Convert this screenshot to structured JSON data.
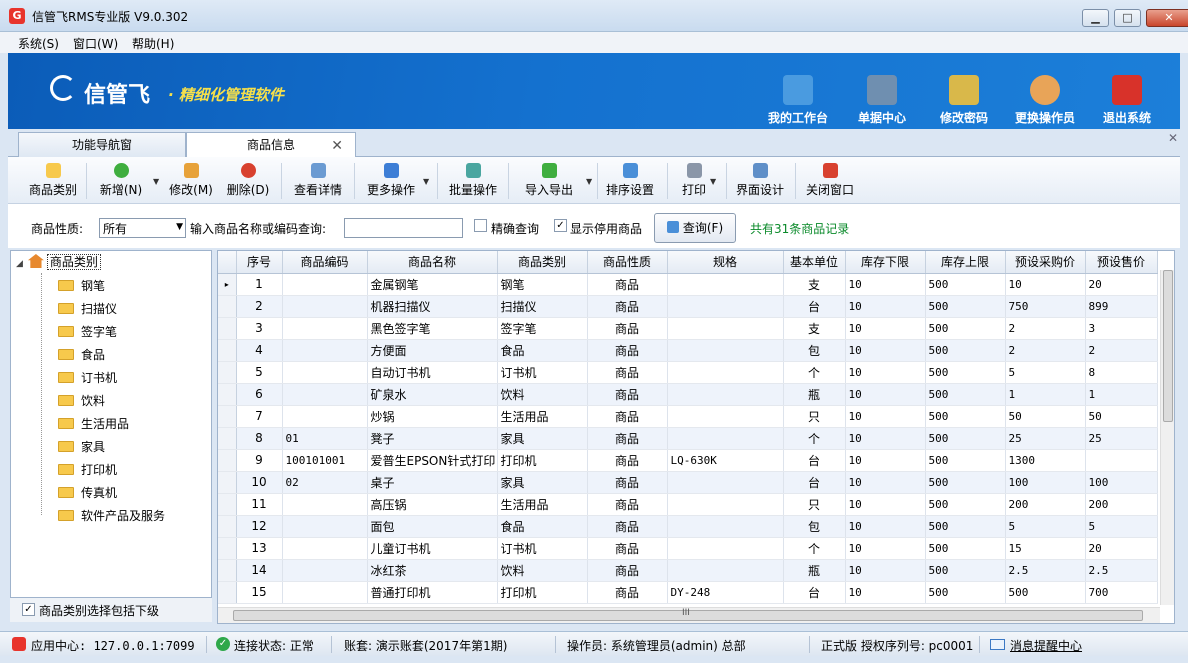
{
  "window": {
    "title": "信管飞RMS专业版 V9.0.302",
    "minimize": "▁",
    "maximize": "□",
    "close": "✕"
  },
  "menu": [
    "系统(S)",
    "窗口(W)",
    "帮助(H)"
  ],
  "banner": {
    "brand": "信管飞",
    "slogan": "· 精细化管理软件",
    "nav": [
      {
        "label": "我的工作台",
        "icon": "monitor-icon",
        "color": "#4a9be0"
      },
      {
        "label": "单据中心",
        "icon": "document-list-icon",
        "color": "#6f8fb0"
      },
      {
        "label": "修改密码",
        "icon": "lock-icon",
        "color": "#d9b84a"
      },
      {
        "label": "更换操作员",
        "icon": "user-icon",
        "color": "#e8a458"
      },
      {
        "label": "退出系统",
        "icon": "power-icon",
        "color": "#d8322a"
      }
    ]
  },
  "tabs": {
    "nav": "功能导航窗",
    "goods": "商品信息",
    "close": "✕"
  },
  "panel_close": "✕",
  "toolbar": [
    {
      "label": "商品类别",
      "icon": "folder-icon",
      "color": "#f7c94c"
    },
    {
      "label": "新增(N)",
      "icon": "add-icon",
      "color": "#3fae3f",
      "dropdown": true
    },
    {
      "label": "修改(M)",
      "icon": "edit-icon",
      "color": "#e7a23a"
    },
    {
      "label": "删除(D)",
      "icon": "delete-icon",
      "color": "#d8412f"
    },
    {
      "label": "查看详情",
      "icon": "details-icon",
      "color": "#6b9bd2"
    },
    {
      "label": "更多操作",
      "icon": "more-icon",
      "color": "#3d7ed6",
      "dropdown": true
    },
    {
      "label": "批量操作",
      "icon": "batch-icon",
      "color": "#4aa6a0"
    },
    {
      "label": "导入导出",
      "icon": "import-export-icon",
      "color": "#3fae3f",
      "dropdown": true
    },
    {
      "label": "排序设置",
      "icon": "sort-icon",
      "color": "#4a8fd8"
    },
    {
      "label": "打印",
      "icon": "print-icon",
      "color": "#8a96a8",
      "dropdown": true
    },
    {
      "label": "界面设计",
      "icon": "layout-icon",
      "color": "#5f8fc8"
    },
    {
      "label": "关闭窗口",
      "icon": "close-window-icon",
      "color": "#d8412f"
    }
  ],
  "filter": {
    "property_label": "商品性质:",
    "property_value": "所有",
    "search_label": "输入商品名称或编码查询:",
    "search_value": "",
    "exact_label": "精确查询",
    "exact_checked": false,
    "show_disabled_label": "显示停用商品",
    "show_disabled_checked": true,
    "query_button": "查询(F)",
    "count_text": "共有31条商品记录"
  },
  "tree": {
    "root": "商品类别",
    "items": [
      "钢笔",
      "扫描仪",
      "签字笔",
      "食品",
      "订书机",
      "饮料",
      "生活用品",
      "家具",
      "打印机",
      "传真机",
      "软件产品及服务"
    ],
    "include_sub_label": "商品类别选择包括下级",
    "include_sub_checked": true
  },
  "grid": {
    "columns": [
      "序号",
      "商品编码",
      "商品名称",
      "商品类别",
      "商品性质",
      "规格",
      "基本单位",
      "库存下限",
      "库存上限",
      "预设采购价",
      "预设售价"
    ],
    "rows": [
      [
        "1",
        "",
        "金属钢笔",
        "钢笔",
        "商品",
        "",
        "支",
        "10",
        "500",
        "10",
        "20"
      ],
      [
        "2",
        "",
        "机器扫描仪",
        "扫描仪",
        "商品",
        "",
        "台",
        "10",
        "500",
        "750",
        "899"
      ],
      [
        "3",
        "",
        "黑色签字笔",
        "签字笔",
        "商品",
        "",
        "支",
        "10",
        "500",
        "2",
        "3"
      ],
      [
        "4",
        "",
        "方便面",
        "食品",
        "商品",
        "",
        "包",
        "10",
        "500",
        "2",
        "2"
      ],
      [
        "5",
        "",
        "自动订书机",
        "订书机",
        "商品",
        "",
        "个",
        "10",
        "500",
        "5",
        "8"
      ],
      [
        "6",
        "",
        "矿泉水",
        "饮料",
        "商品",
        "",
        "瓶",
        "10",
        "500",
        "1",
        "1"
      ],
      [
        "7",
        "",
        "炒锅",
        "生活用品",
        "商品",
        "",
        "只",
        "10",
        "500",
        "50",
        "50"
      ],
      [
        "8",
        "01",
        "凳子",
        "家具",
        "商品",
        "",
        "个",
        "10",
        "500",
        "25",
        "25"
      ],
      [
        "9",
        "100101001",
        "爱普生EPSON针式打印",
        "打印机",
        "商品",
        "LQ-630K",
        "台",
        "10",
        "500",
        "1300",
        ""
      ],
      [
        "10",
        "02",
        "桌子",
        "家具",
        "商品",
        "",
        "台",
        "10",
        "500",
        "100",
        "100"
      ],
      [
        "11",
        "",
        "高压锅",
        "生活用品",
        "商品",
        "",
        "只",
        "10",
        "500",
        "200",
        "200"
      ],
      [
        "12",
        "",
        "面包",
        "食品",
        "商品",
        "",
        "包",
        "10",
        "500",
        "5",
        "5"
      ],
      [
        "13",
        "",
        "儿童订书机",
        "订书机",
        "商品",
        "",
        "个",
        "10",
        "500",
        "15",
        "20"
      ],
      [
        "14",
        "",
        "冰红茶",
        "饮料",
        "商品",
        "",
        "瓶",
        "10",
        "500",
        "2.5",
        "2.5"
      ],
      [
        "15",
        "",
        "普通打印机",
        "打印机",
        "商品",
        "DY-248",
        "台",
        "10",
        "500",
        "500",
        "700"
      ]
    ],
    "current_row_marker": "▸",
    "hscroll_grip": "III"
  },
  "status": {
    "app_center": "应用中心: 127.0.0.1:7099",
    "connection": "连接状态: 正常",
    "account": "账套: 演示账套(2017年第1期)",
    "operator": "操作员: 系统管理员(admin) 总部",
    "license": "正式版 授权序列号: pc0001",
    "message_center": "消息提醒中心"
  }
}
